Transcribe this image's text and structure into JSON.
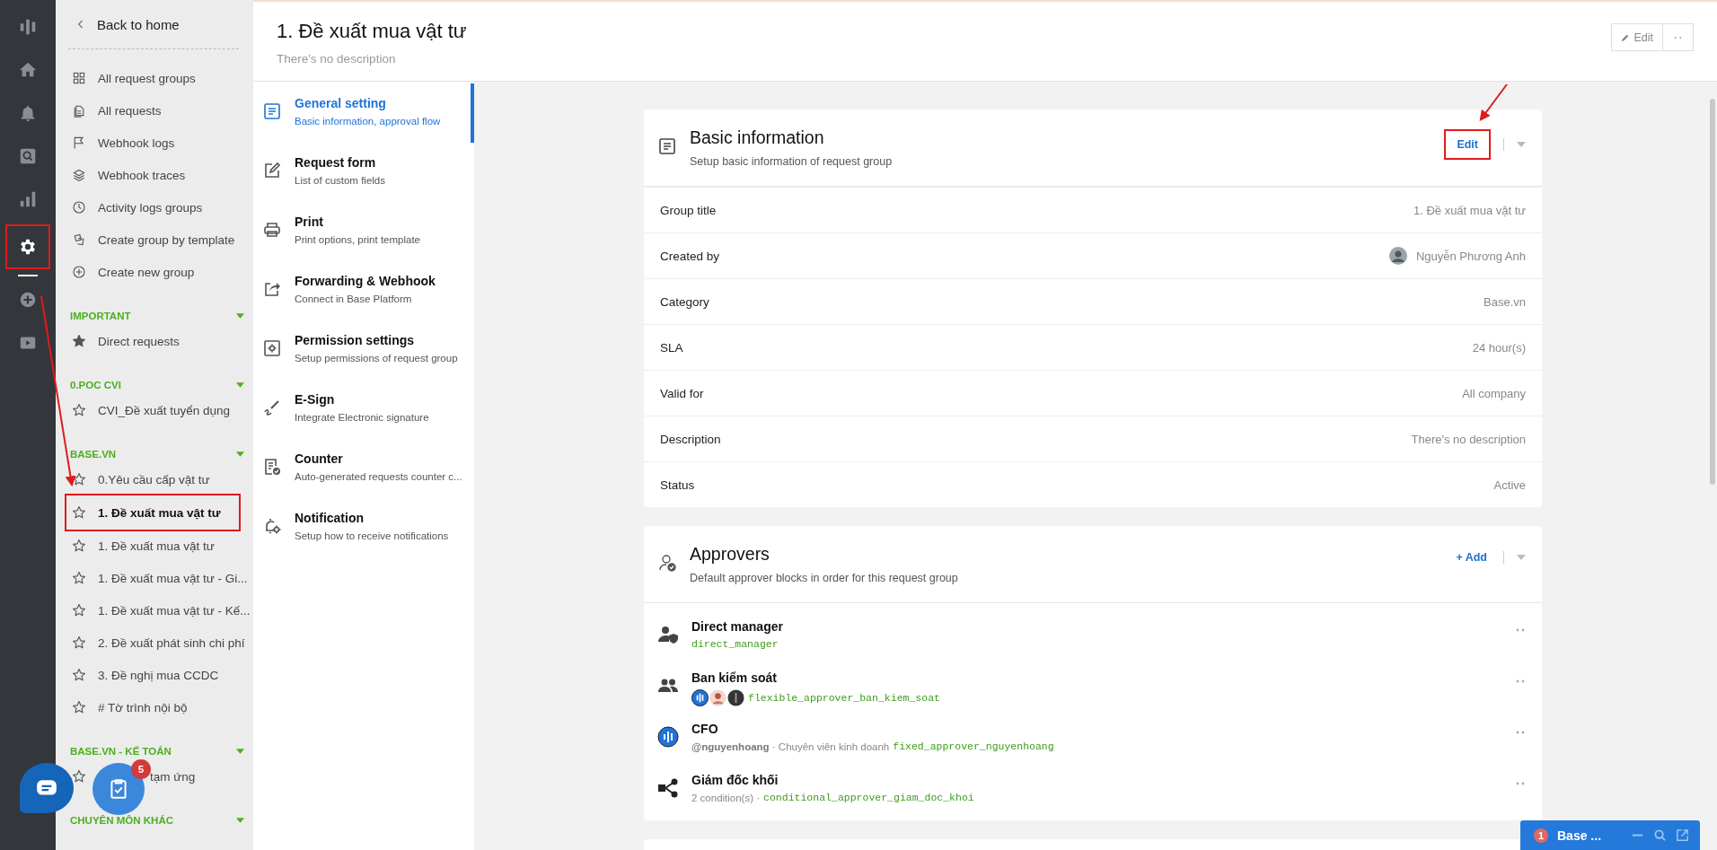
{
  "rail": {
    "items": [
      {
        "kind": "logo",
        "selected": false,
        "highlighted": false
      },
      {
        "kind": "home",
        "selected": false,
        "highlighted": false
      },
      {
        "kind": "bell",
        "selected": false,
        "highlighted": false
      },
      {
        "kind": "search",
        "selected": false,
        "highlighted": false
      },
      {
        "kind": "chart",
        "selected": false,
        "highlighted": false
      },
      {
        "kind": "gear",
        "selected": true,
        "highlighted": true
      },
      {
        "kind": "plus",
        "selected": false,
        "highlighted": false
      },
      {
        "kind": "play",
        "selected": false,
        "highlighted": false
      }
    ]
  },
  "sidebar": {
    "back": "Back to home",
    "menu": [
      {
        "kind": "grid",
        "label": "All request groups"
      },
      {
        "kind": "files",
        "label": "All requests"
      },
      {
        "kind": "flag",
        "label": "Webhook logs"
      },
      {
        "kind": "layers",
        "label": "Webhook traces"
      },
      {
        "kind": "clock",
        "label": "Activity logs groups"
      },
      {
        "kind": "template",
        "label": "Create group by template"
      },
      {
        "kind": "plus",
        "label": "Create new group"
      }
    ],
    "groups": [
      {
        "title": "IMPORTANT",
        "expanded": true,
        "items": [
          {
            "label": "Direct requests",
            "starred": true,
            "selected": false,
            "highlighted": false,
            "covered": false
          }
        ]
      },
      {
        "title": "0.POC CVI",
        "expanded": true,
        "items": [
          {
            "label": "CVI_Đề xuất tuyển dụng",
            "starred": false,
            "selected": false,
            "highlighted": false,
            "covered": false
          }
        ]
      },
      {
        "title": "BASE.VN",
        "expanded": true,
        "items": [
          {
            "label": "0.Yêu cầu cấp vật tư",
            "starred": false,
            "selected": false,
            "highlighted": false,
            "covered": false
          },
          {
            "label": "1. Đề xuất mua vật tư",
            "starred": false,
            "selected": true,
            "highlighted": true,
            "covered": false
          },
          {
            "label": "1. Đề xuất mua vật tư",
            "starred": false,
            "selected": false,
            "highlighted": false,
            "covered": false
          },
          {
            "label": "1. Đề xuất mua vật tư - Gi...",
            "starred": false,
            "selected": false,
            "highlighted": false,
            "covered": false
          },
          {
            "label": "1. Đề xuất mua vật tư - Kế...",
            "starred": false,
            "selected": false,
            "highlighted": false,
            "covered": false
          },
          {
            "label": "2. Đề xuất phát sinh chi phí",
            "starred": false,
            "selected": false,
            "highlighted": false,
            "covered": false
          },
          {
            "label": "3. Đề nghị mua CCDC",
            "starred": false,
            "selected": false,
            "highlighted": false,
            "covered": false
          },
          {
            "label": "# Tờ trình nội bộ",
            "starred": false,
            "selected": false,
            "highlighted": false,
            "covered": false
          }
        ]
      },
      {
        "title": "BASE.VN - KẾ TOÁN",
        "expanded": true,
        "items": [
          {
            "label": "tạm ứng",
            "starred": false,
            "selected": false,
            "highlighted": false,
            "covered": true
          }
        ]
      },
      {
        "title": "CHUYÊN MÔN KHÁC",
        "expanded": true
      }
    ]
  },
  "page": {
    "title": "1. Đề xuất mua vật tư",
    "description": "There's no description",
    "edit_button": "Edit"
  },
  "nav": [
    {
      "kind": "doc",
      "title": "General setting",
      "subtitle": "Basic information, approval flow",
      "selected": true
    },
    {
      "kind": "edit",
      "title": "Request form",
      "subtitle": "List of custom fields",
      "selected": false
    },
    {
      "kind": "print",
      "title": "Print",
      "subtitle": "Print options, print template",
      "selected": false
    },
    {
      "kind": "share",
      "title": "Forwarding & Webhook",
      "subtitle": "Connect in Base Platform",
      "selected": false
    },
    {
      "kind": "perm",
      "title": "Permission settings",
      "subtitle": "Setup permissions of request group",
      "selected": false
    },
    {
      "kind": "sign",
      "title": "E-Sign",
      "subtitle": "Integrate Electronic signature",
      "selected": false
    },
    {
      "kind": "counter",
      "title": "Counter",
      "subtitle": "Auto-generated requests counter c...",
      "selected": false
    },
    {
      "kind": "bellgear",
      "title": "Notification",
      "subtitle": "Setup how to receive notifications",
      "selected": false
    }
  ],
  "basic_info": {
    "title": "Basic information",
    "subtitle": "Setup basic information of request group",
    "edit": "Edit",
    "edit_highlighted": true,
    "rows": [
      {
        "label": "Group title",
        "value": "1. Đề xuất mua vật tư",
        "avatar": false
      },
      {
        "label": "Created by",
        "value": "Nguyễn Phương Anh",
        "avatar": true
      },
      {
        "label": "Category",
        "value": "Base.vn",
        "avatar": false
      },
      {
        "label": "SLA",
        "value": "24 hour(s)",
        "avatar": false
      },
      {
        "label": "Valid for",
        "value": "All company",
        "avatar": false
      },
      {
        "label": "Description",
        "value": "There's no description",
        "avatar": false
      },
      {
        "label": "Status",
        "value": "Active",
        "avatar": false
      }
    ]
  },
  "approvers": {
    "title": "Approvers",
    "subtitle": "Default approver blocks in order for this request group",
    "add": "+ Add",
    "items": [
      {
        "kind": "manager",
        "name": "Direct manager",
        "code": "direct_manager"
      },
      {
        "kind": "group",
        "name": "Ban kiểm soát",
        "avatars": [
          {
            "kind": "logo"
          },
          {
            "kind": "person"
          },
          {
            "kind": "dark"
          }
        ],
        "code": "flexible_approver_ban_kiem_soat"
      },
      {
        "kind": "logo",
        "name": "CFO",
        "meta": "**@nguyenhoang** · Chuyên viên kinh doanh",
        "code": "fixed_approver_nguyenhoang"
      },
      {
        "kind": "branch",
        "name": "Giám đốc khối",
        "meta": "2 condition(s) ·",
        "code": "conditional_approver_giam_doc_khoi"
      }
    ]
  },
  "floating": {
    "task_badge": "5"
  },
  "chat_widget": {
    "badge": "1",
    "title": "Base ..."
  }
}
